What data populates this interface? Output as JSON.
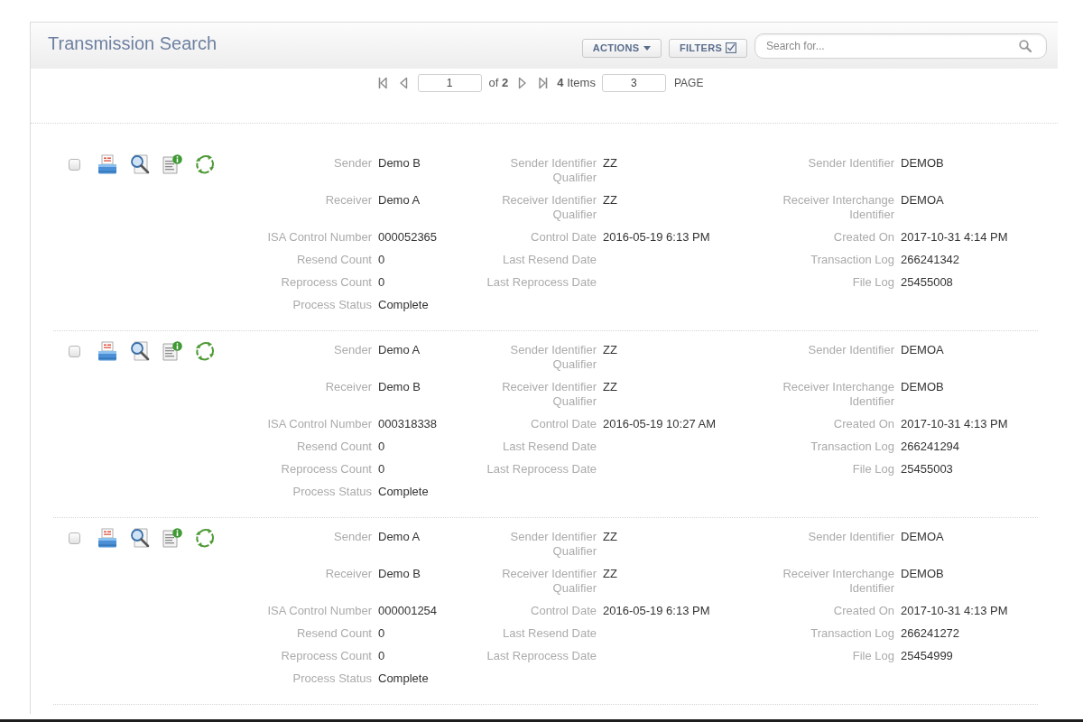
{
  "header": {
    "title": "Transmission Search",
    "actions_button": "ACTIONS",
    "filters_button": "FILTERS",
    "search": {
      "placeholder": "Search for..."
    }
  },
  "pager": {
    "page": "1",
    "of_pages": "of **2**",
    "items": "**4** Items",
    "page_size": "3",
    "page_size_label": "PAGE"
  },
  "records": [
    {
      "checked": false,
      "rows": [
        [
          {
            "label": "Sender",
            "value": "Demo B"
          },
          {
            "label": "Sender Identifier Qualifier",
            "value": "ZZ"
          },
          {
            "label": "Sender Identifier",
            "value": "DEMOB"
          }
        ],
        [
          {
            "label": "Receiver",
            "value": "Demo A"
          },
          {
            "label": "Receiver Identifier Qualifier",
            "value": "ZZ"
          },
          {
            "label": "Receiver Interchange Identifier",
            "value": "DEMOA"
          }
        ],
        [
          {
            "label": "ISA Control Number",
            "value": "000052365"
          },
          {
            "label": "Control Date",
            "value": "2016-05-19 6:13 PM"
          },
          {
            "label": "Created On",
            "value": "2017-10-31 4:14 PM"
          }
        ],
        [
          {
            "label": "Resend Count",
            "value": "0"
          },
          {
            "label": "Last Resend Date"
          },
          {
            "label": "Transaction Log",
            "value": "266241342"
          }
        ],
        [
          {
            "label": "Reprocess Count",
            "value": "0"
          },
          {
            "label": "Last Reprocess Date"
          },
          {
            "label": "File Log",
            "value": "25455008"
          }
        ],
        [
          {
            "label": "Process Status",
            "value": "Complete"
          }
        ]
      ]
    },
    {
      "checked": false,
      "rows": [
        [
          {
            "label": "Sender",
            "value": "Demo A"
          },
          {
            "label": "Sender Identifier Qualifier",
            "value": "ZZ"
          },
          {
            "label": "Sender Identifier",
            "value": "DEMOA"
          }
        ],
        [
          {
            "label": "Receiver",
            "value": "Demo B"
          },
          {
            "label": "Receiver Identifier Qualifier",
            "value": "ZZ"
          },
          {
            "label": "Receiver Interchange Identifier",
            "value": "DEMOB"
          }
        ],
        [
          {
            "label": "ISA Control Number",
            "value": "000318338"
          },
          {
            "label": "Control Date",
            "value": "2016-05-19 10:27 AM"
          },
          {
            "label": "Created On",
            "value": "2017-10-31 4:13 PM"
          }
        ],
        [
          {
            "label": "Resend Count",
            "value": "0"
          },
          {
            "label": "Last Resend Date"
          },
          {
            "label": "Transaction Log",
            "value": "266241294"
          }
        ],
        [
          {
            "label": "Reprocess Count",
            "value": "0"
          },
          {
            "label": "Last Reprocess Date"
          },
          {
            "label": "File Log",
            "value": "25455003"
          }
        ],
        [
          {
            "label": "Process Status",
            "value": "Complete"
          }
        ]
      ]
    },
    {
      "checked": false,
      "rows": [
        [
          {
            "label": "Sender",
            "value": "Demo A"
          },
          {
            "label": "Sender Identifier Qualifier",
            "value": "ZZ"
          },
          {
            "label": "Sender Identifier",
            "value": "DEMOA"
          }
        ],
        [
          {
            "label": "Receiver",
            "value": "Demo B"
          },
          {
            "label": "Receiver Identifier Qualifier",
            "value": "ZZ"
          },
          {
            "label": "Receiver Interchange Identifier",
            "value": "DEMOB"
          }
        ],
        [
          {
            "label": "ISA Control Number",
            "value": "000001254"
          },
          {
            "label": "Control Date",
            "value": "2016-05-19 6:13 PM"
          },
          {
            "label": "Created On",
            "value": "2017-10-31 4:13 PM"
          }
        ],
        [
          {
            "label": "Resend Count",
            "value": "0"
          },
          {
            "label": "Last Resend Date"
          },
          {
            "label": "Transaction Log",
            "value": "266241272"
          }
        ],
        [
          {
            "label": "Reprocess Count",
            "value": "0"
          },
          {
            "label": "Last Reprocess Date"
          },
          {
            "label": "File Log",
            "value": "25454999"
          }
        ],
        [
          {
            "label": "Process Status",
            "value": "Complete"
          }
        ]
      ]
    }
  ]
}
